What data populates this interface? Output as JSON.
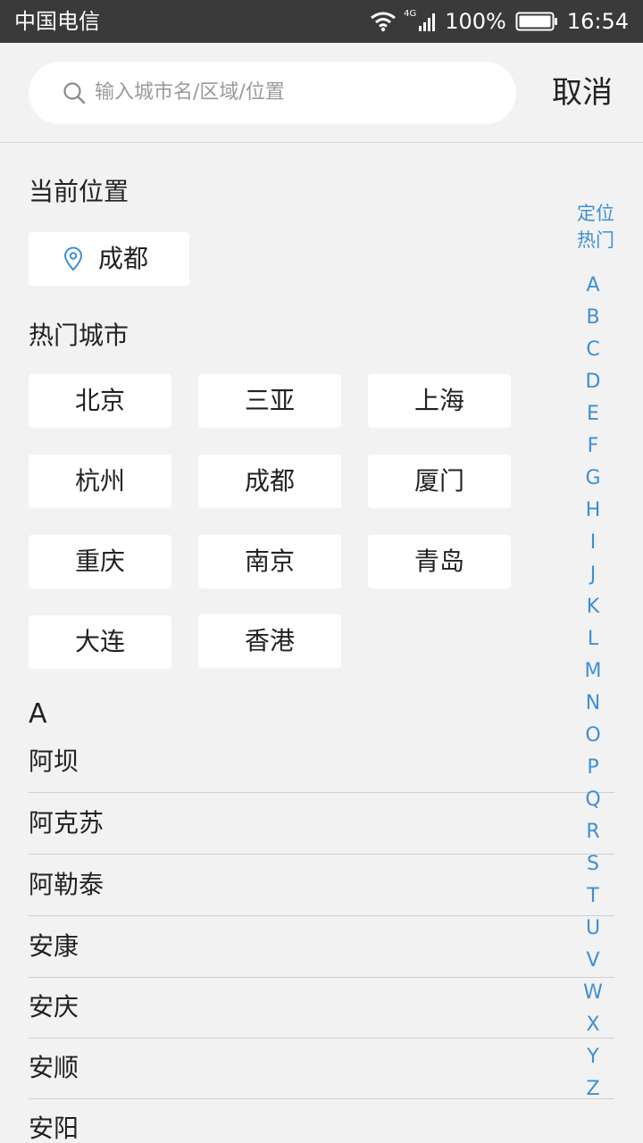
{
  "status_bar": {
    "carrier": "中国电信",
    "network": "4G",
    "battery_pct": "100%",
    "time": "16:54"
  },
  "search": {
    "placeholder": "输入城市名/区域/位置",
    "cancel_label": "取消"
  },
  "current_location": {
    "title": "当前位置",
    "city": "成都"
  },
  "hot_cities": {
    "title": "热门城市",
    "cities": [
      "北京",
      "三亚",
      "上海",
      "杭州",
      "成都",
      "厦门",
      "重庆",
      "南京",
      "青岛",
      "大连",
      "香港"
    ]
  },
  "city_list": {
    "group_letter": "A",
    "cities": [
      "阿坝",
      "阿克苏",
      "阿勒泰",
      "安康",
      "安庆",
      "安顺",
      "安阳"
    ]
  },
  "side_index": {
    "locate_label": "定位",
    "hot_label": "热门",
    "letters": [
      "A",
      "B",
      "C",
      "D",
      "E",
      "F",
      "G",
      "H",
      "I",
      "J",
      "K",
      "L",
      "M",
      "N",
      "O",
      "P",
      "Q",
      "R",
      "S",
      "T",
      "U",
      "V",
      "W",
      "X",
      "Y",
      "Z"
    ]
  },
  "colors": {
    "accent": "#3d8fd6",
    "status_bar_bg": "#3a3a3a",
    "page_bg": "#f2f2f2"
  }
}
